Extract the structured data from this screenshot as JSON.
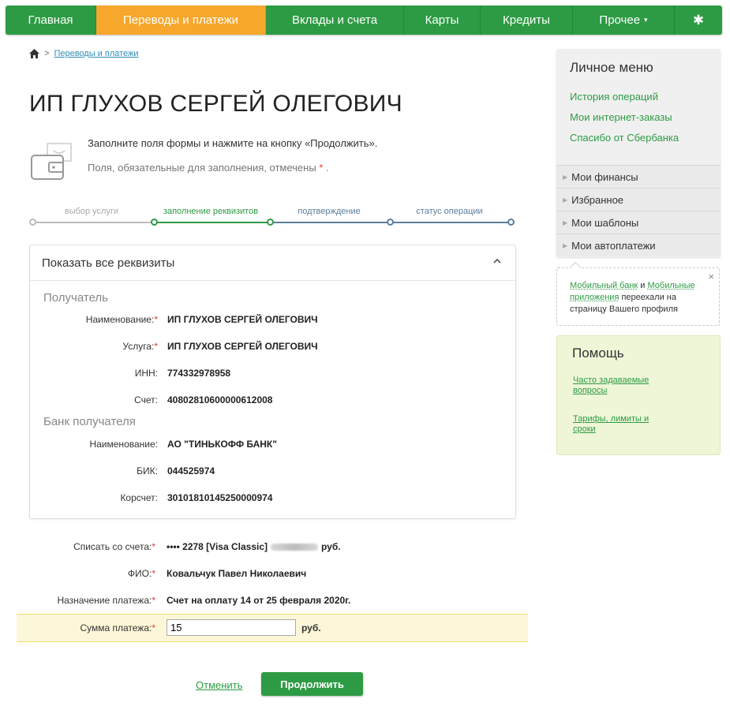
{
  "nav": {
    "items": [
      {
        "label": "Главная"
      },
      {
        "label": "Переводы и платежи"
      },
      {
        "label": "Вклады и счета"
      },
      {
        "label": "Карты"
      },
      {
        "label": "Кредиты"
      },
      {
        "label": "Прочее"
      }
    ],
    "more_caret": "▾",
    "gear_glyph": "✱"
  },
  "breadcrumb": {
    "separator": ">",
    "current": "Переводы и платежи"
  },
  "page_title": "ИП ГЛУХОВ СЕРГЕЙ ОЛЕГОВИЧ",
  "info": {
    "line1": "Заполните поля формы и нажмите на кнопку «Продолжить».",
    "line2": "Поля, обязательные для заполнения, отмечены",
    "required_mark": "*",
    "line2_end": "."
  },
  "stepper": {
    "steps": [
      {
        "label": "выбор услуги"
      },
      {
        "label": "заполнение реквизитов"
      },
      {
        "label": "подтверждение"
      },
      {
        "label": "статус операции"
      }
    ],
    "colors": {
      "done": "#bbbbbb",
      "active": "#2d9b44",
      "pending": "#5a7ea0"
    }
  },
  "details": {
    "toggle_label": "Показать все реквизиты",
    "recipient_title": "Получатель",
    "recipient": [
      {
        "label": "Наименование:",
        "required": true,
        "value": "ИП ГЛУХОВ СЕРГЕЙ ОЛЕГОВИЧ"
      },
      {
        "label": "Услуга:",
        "required": true,
        "value": "ИП ГЛУХОВ СЕРГЕЙ ОЛЕГОВИЧ"
      },
      {
        "label": "ИНН:",
        "required": false,
        "value": "774332978958"
      },
      {
        "label": "Счет:",
        "required": false,
        "value": "40802810600000612008"
      }
    ],
    "bank_title": "Банк получателя",
    "bank": [
      {
        "label": "Наименование:",
        "required": false,
        "value": "АО \"ТИНЬКОФФ БАНК\""
      },
      {
        "label": "БИК:",
        "required": false,
        "value": "044525974"
      },
      {
        "label": "Корсчет:",
        "required": false,
        "value": "30101810145250000974"
      }
    ]
  },
  "form": {
    "account_label": "Списать со счета:",
    "account_value": "•••• 2278  [Visa Classic]",
    "account_currency": "руб.",
    "fio_label": "ФИО:",
    "fio_value": "Ковальчук Павел Николаевич",
    "purpose_label": "Назначение платежа:",
    "purpose_value": "Счет на оплату 14 от 25 февраля 2020г.",
    "amount_label": "Сумма платежа:",
    "amount_value": "15",
    "amount_currency": "руб.",
    "required_mark": "*"
  },
  "actions": {
    "cancel_label": "Отменить",
    "continue_label": "Продолжить"
  },
  "sidebar": {
    "menu_title": "Личное меню",
    "links": [
      {
        "label": "История операций"
      },
      {
        "label": "Мои интернет-заказы"
      },
      {
        "label": "Спасибо от Сбербанка"
      }
    ],
    "sections": [
      {
        "label": "Мои финансы"
      },
      {
        "label": "Избранное"
      },
      {
        "label": "Мои шаблоны"
      },
      {
        "label": "Мои автоплатежи"
      }
    ],
    "notice": {
      "link1": "Мобильный банк",
      "and": " и ",
      "link2": "Мобильные приложения",
      "text": " переехали на страницу Вашего профиля",
      "close": "×"
    },
    "help": {
      "title": "Помощь",
      "links": [
        {
          "label": "Часто задаваемые вопросы"
        },
        {
          "label": "Тарифы, лимиты и сроки"
        }
      ]
    }
  },
  "colors": {
    "brand_green": "#2d9b44",
    "active_tab": "#f6a72c",
    "required": "#e53935"
  }
}
